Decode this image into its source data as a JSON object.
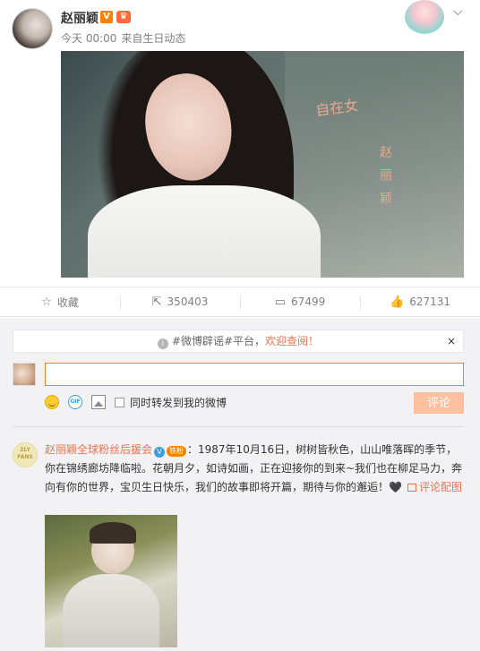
{
  "post": {
    "username": "赵丽颖",
    "verified_badge": "V",
    "meta": {
      "time": "今天 00:00",
      "source_prefix": "来自",
      "source": "生日动态"
    }
  },
  "actions": {
    "favorite_label": "收藏",
    "repost_count": "350403",
    "comment_count": "67499",
    "like_count": "627131"
  },
  "comment_box": {
    "notice_hashtag": "#微博辟谣#平台，",
    "notice_highlight": "欢迎查阅！",
    "notice_close": "×",
    "input_value": "",
    "repost_option_label": "同时转发到我的微博",
    "submit_label": "评论",
    "gif_label": "GIF"
  },
  "fan_comment": {
    "user": "赵丽颖全球粉丝后援会",
    "level_badge": "铁粉",
    "text": "：1987年10月16日，树树皆秋色，山山唯落晖的季节，你在锦绣廊坊降临啦。花朝月夕，如诗如画，正在迎接你的到来~我们也在柳足马力，奔向有你的世界，宝贝生日快乐，我们的故事即将开篇，期待与你的邂逅！",
    "heart": "🖤",
    "link_label": "评论配图"
  },
  "photo_overlay": {
    "script_text": "自在女",
    "name_text": "赵丽颖"
  },
  "colors": {
    "accent": "#eb7350",
    "link": "#eb7350",
    "input_border": "#fa7d3c",
    "button_disabled": "#ffc09f"
  }
}
